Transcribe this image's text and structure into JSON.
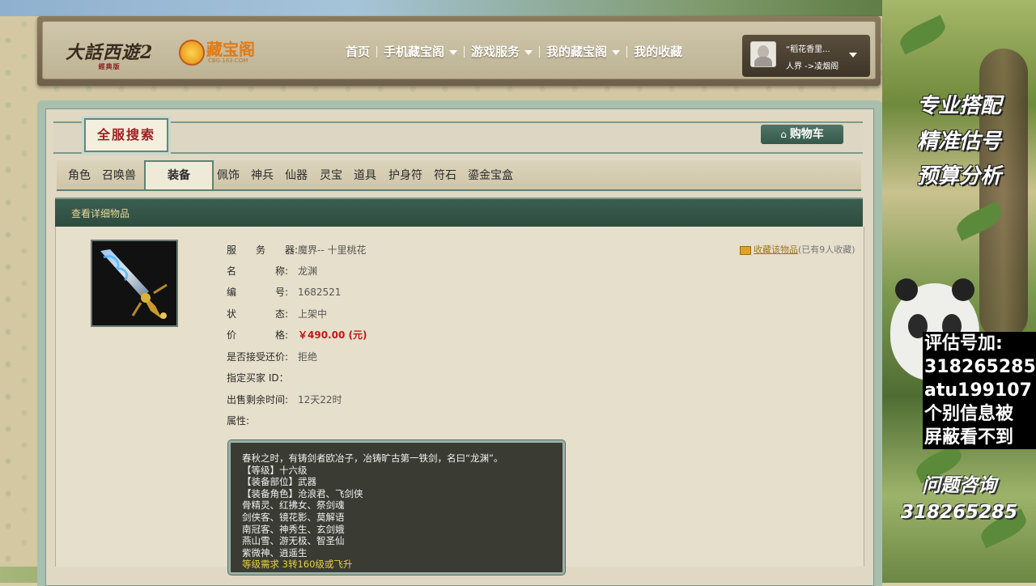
{
  "header": {
    "game_logo": "大話西遊2",
    "game_logo_sub": "經典版",
    "cbg_logo": "藏宝阁",
    "cbg_domain": "CBG.163.COM",
    "nav": [
      {
        "label": "首页",
        "has_dropdown": false
      },
      {
        "label": "手机藏宝阁",
        "has_dropdown": true
      },
      {
        "label": "游戏服务",
        "has_dropdown": true
      },
      {
        "label": "我的藏宝阁",
        "has_dropdown": true
      },
      {
        "label": "我的收藏",
        "has_dropdown": false
      }
    ],
    "user": {
      "name": "“稻花香里...",
      "server": "人界 ->凌烟阁"
    }
  },
  "search": {
    "title": "全服搜索",
    "cart_label": "购物车"
  },
  "tabs": [
    {
      "label": "角色",
      "active": false
    },
    {
      "label": "召唤兽",
      "active": false
    },
    {
      "label": "装备",
      "active": true
    },
    {
      "label": "佩饰",
      "active": false
    },
    {
      "label": "神兵",
      "active": false
    },
    {
      "label": "仙器",
      "active": false
    },
    {
      "label": "灵宝",
      "active": false
    },
    {
      "label": "道具",
      "active": false
    },
    {
      "label": "护身符",
      "active": false
    },
    {
      "label": "符石",
      "active": false
    },
    {
      "label": "鎏金宝盒",
      "active": false
    }
  ],
  "section": {
    "title": "查看详细物品"
  },
  "item": {
    "fields": [
      {
        "label": "服　　务　　器:",
        "value": "魔界-- 十里桃花"
      },
      {
        "label": "名　　　　称:",
        "value": "龙渊"
      },
      {
        "label": "编　　　　号:",
        "value": "1682521"
      },
      {
        "label": "状　　　　态:",
        "value": "上架中"
      },
      {
        "label": "价　　　　格:",
        "value": "￥490.00 (元)"
      },
      {
        "label": "是否接受还价:",
        "value": "拒绝"
      },
      {
        "label": "指定买家 ID：",
        "value": ""
      },
      {
        "label": "出售剩余时间:",
        "value": "12天22时"
      },
      {
        "label": "属性:",
        "value": ""
      }
    ],
    "favorite_link": "收藏该物品",
    "favorite_count": "(已有9人收藏)",
    "tooltip_lines": [
      {
        "text": "春秋之时，有铸剑者欧冶子，冶铸旷古第一铁剑，名曰“龙渊”。",
        "color": "#f2f2f2"
      },
      {
        "text": "【等级】十六级",
        "color": "#f2f2f2"
      },
      {
        "text": "【装备部位】武器",
        "color": "#f2f2f2"
      },
      {
        "text": "【装备角色】沧浪君、飞剑侠",
        "color": "#f2f2f2"
      },
      {
        "text": "骨精灵、红拂女、祭剑魂",
        "color": "#f2f2f2"
      },
      {
        "text": "剑侠客、镜花影、莫解语",
        "color": "#f2f2f2"
      },
      {
        "text": "南冠客、神秀生、玄剑娥",
        "color": "#f2f2f2"
      },
      {
        "text": "燕山雪、游无极、智圣仙",
        "color": "#f2f2f2"
      },
      {
        "text": "紫微神、逍遥生",
        "color": "#f2f2f2"
      },
      {
        "text": "等级需求 3转160级或飞升",
        "color": "#e8d33a"
      }
    ]
  },
  "promo": {
    "lines": [
      "专业搭配",
      "精准估号",
      "预算分析"
    ],
    "contact": [
      "评估号加:",
      "318265285",
      "atu199107",
      "个别信息被",
      "屏蔽看不到"
    ],
    "consult_label": "问题咨询",
    "consult_number": "318265285"
  },
  "colors": {
    "price": "#c01818",
    "accent_green": "#3c5e51",
    "logo_red": "#9a1f1f"
  }
}
